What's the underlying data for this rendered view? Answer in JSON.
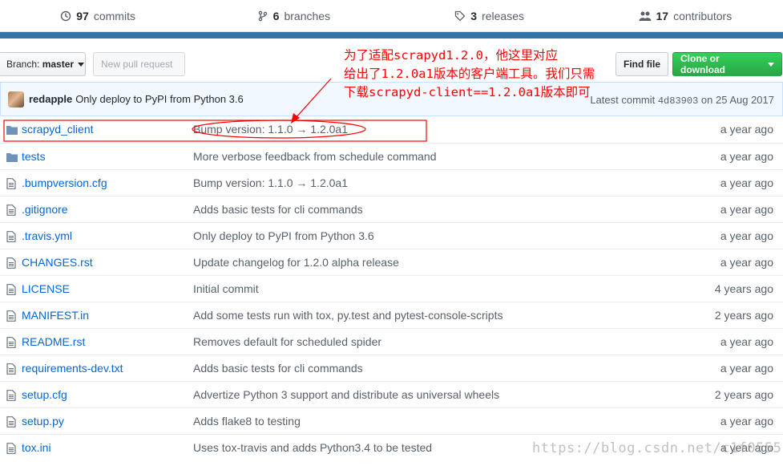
{
  "summary": {
    "commits_count": "97",
    "commits_label": "commits",
    "branches_count": "6",
    "branches_label": "branches",
    "releases_count": "3",
    "releases_label": "releases",
    "contributors_count": "17",
    "contributors_label": "contributors"
  },
  "language_color": "#3572A5",
  "toolbar": {
    "branch_prefix": "Branch:",
    "branch_name": "master",
    "new_pr_label": "New pull request",
    "find_file_label": "Find file",
    "clone_label": "Clone or download"
  },
  "latest_commit": {
    "author": "redapple",
    "message": "Only deploy to PyPI from Python 3.6",
    "prefix": "Latest commit",
    "sha": "4d83903",
    "date": "on 25 Aug 2017"
  },
  "files": [
    {
      "type": "dir",
      "name": "scrapyd_client",
      "message": "Bump version: 1.1.0 → 1.2.0a1",
      "age": "a year ago"
    },
    {
      "type": "dir",
      "name": "tests",
      "message": "More verbose feedback from schedule command",
      "age": "a year ago"
    },
    {
      "type": "file",
      "name": ".bumpversion.cfg",
      "message": "Bump version: 1.1.0 → 1.2.0a1",
      "age": "a year ago"
    },
    {
      "type": "file",
      "name": ".gitignore",
      "message": "Adds basic tests for cli commands",
      "age": "a year ago"
    },
    {
      "type": "file",
      "name": ".travis.yml",
      "message": "Only deploy to PyPI from Python 3.6",
      "age": "a year ago"
    },
    {
      "type": "file",
      "name": "CHANGES.rst",
      "message": "Update changelog for 1.2.0 alpha release",
      "age": "a year ago"
    },
    {
      "type": "file",
      "name": "LICENSE",
      "message": "Initial commit",
      "age": "4 years ago"
    },
    {
      "type": "file",
      "name": "MANIFEST.in",
      "message": "Add some tests run with tox, py.test and pytest-console-scripts",
      "age": "2 years ago"
    },
    {
      "type": "file",
      "name": "README.rst",
      "message": "Removes default for scheduled spider",
      "age": "a year ago"
    },
    {
      "type": "file",
      "name": "requirements-dev.txt",
      "message": "Adds basic tests for cli commands",
      "age": "a year ago"
    },
    {
      "type": "file",
      "name": "setup.cfg",
      "message": "Advertize Python 3 support and distribute as universal wheels",
      "age": "2 years ago"
    },
    {
      "type": "file",
      "name": "setup.py",
      "message": "Adds flake8 to testing",
      "age": "a year ago"
    },
    {
      "type": "file",
      "name": "tox.ini",
      "message": "Uses tox-travis and adds Python3.4 to be tested",
      "age": "a year ago"
    }
  ],
  "annotation": {
    "line1": "为了适配scrapyd1.2.0，他这里对应",
    "line2": "给出了1.2.0a1版本的客户端工具。我们只需",
    "line3": "下载scrapyd-client==1.2.0a1版本即可",
    "color": "#ff0000"
  },
  "watermark": "https://blog.csdn.net/c1f0555"
}
